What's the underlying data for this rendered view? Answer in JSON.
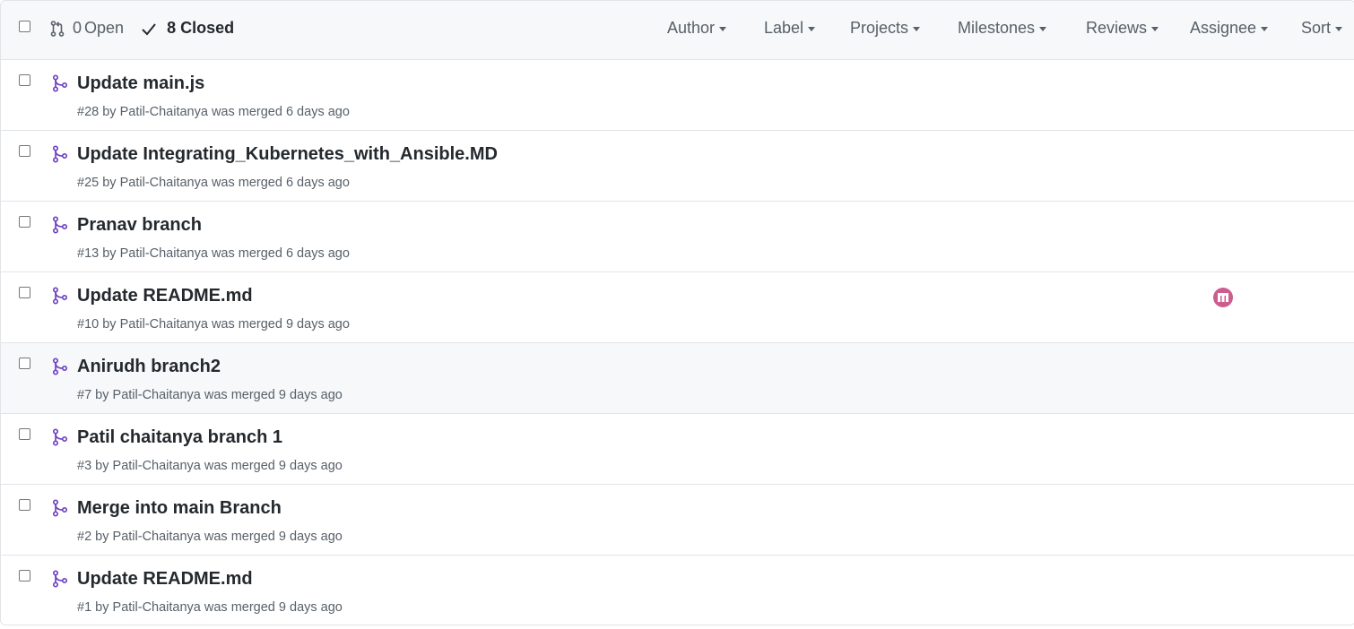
{
  "header": {
    "open_count": "0",
    "open_label": "Open",
    "closed_count": "8",
    "closed_label": "Closed",
    "filters": [
      "Author",
      "Label",
      "Projects",
      "Milestones",
      "Reviews",
      "Assignee",
      "Sort"
    ]
  },
  "pulls": [
    {
      "title": "Update main.js",
      "number": "#28",
      "by": "by",
      "author": "Patil-Chaitanya",
      "status": "was merged",
      "time": "6 days ago",
      "assignee_icon": ""
    },
    {
      "title": "Update Integrating_Kubernetes_with_Ansible.MD",
      "number": "#25",
      "by": "by",
      "author": "Patil-Chaitanya",
      "status": "was merged",
      "time": "6 days ago",
      "assignee_icon": ""
    },
    {
      "title": "Pranav branch",
      "number": "#13",
      "by": "by",
      "author": "Patil-Chaitanya",
      "status": "was merged",
      "time": "6 days ago",
      "assignee_icon": ""
    },
    {
      "title": "Update README.md",
      "number": "#10",
      "by": "by",
      "author": "Patil-Chaitanya",
      "status": "was merged",
      "time": "9 days ago",
      "assignee_icon": "identicon-avatar"
    },
    {
      "title": "Anirudh branch2",
      "number": "#7",
      "by": "by",
      "author": "Patil-Chaitanya",
      "status": "was merged",
      "time": "9 days ago",
      "assignee_icon": ""
    },
    {
      "title": "Patil chaitanya branch 1",
      "number": "#3",
      "by": "by",
      "author": "Patil-Chaitanya",
      "status": "was merged",
      "time": "9 days ago",
      "assignee_icon": ""
    },
    {
      "title": "Merge into main Branch",
      "number": "#2",
      "by": "by",
      "author": "Patil-Chaitanya",
      "status": "was merged",
      "time": "9 days ago",
      "assignee_icon": ""
    },
    {
      "title": "Update README.md",
      "number": "#1",
      "by": "by",
      "author": "Patil-Chaitanya",
      "status": "was merged",
      "time": "9 days ago",
      "assignee_icon": ""
    }
  ],
  "icons": {
    "open_state": "git-pull-request-icon",
    "closed_state": "check-icon",
    "merged": "git-merge-icon"
  },
  "colors": {
    "merged_purple": "#6f42c1",
    "avatar_pink": "#cc5d8e",
    "header_bg": "#f6f8fa",
    "hover_row_bg": "#f6f8fa",
    "border": "#e1e4e8",
    "muted_text": "#586069",
    "text": "#24292e"
  }
}
